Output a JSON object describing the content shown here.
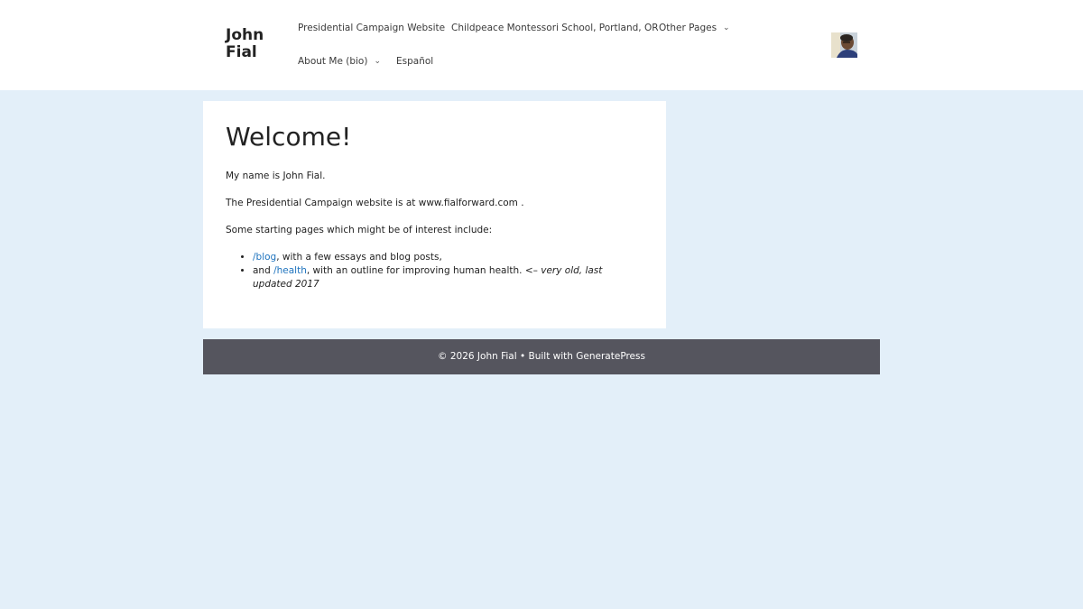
{
  "header": {
    "site_title": "John Fial",
    "nav": {
      "campaign": "Presidential Campaign Website",
      "school": "Childpeace Montessori School, Portland, OR",
      "other_pages": "Other Pages",
      "about": "About Me (bio)",
      "espanol": "Español"
    },
    "chevron_glyph": "⌄"
  },
  "main": {
    "title": "Welcome!",
    "para1": "My name is John Fial.",
    "para2": "The Presidential Campaign website is at www.fialforward.com .",
    "para3": "Some starting pages which might be of interest include:",
    "bullets": [
      {
        "prefix": "",
        "link": "/blog",
        "text": ", with a few essays and blog posts,",
        "note": ""
      },
      {
        "prefix": "and ",
        "link": "/health",
        "text": ", with an outline for improving human health. <– ",
        "note": "very old, last updated 2017"
      }
    ]
  },
  "footer": {
    "copyright": "© 2026 John Fial",
    "separator": " • ",
    "built_with": "Built with ",
    "theme_link": "GeneratePress"
  },
  "colors": {
    "page_bg": "#e3eff9",
    "link": "#1e73be",
    "footer_bg": "#55555e"
  }
}
